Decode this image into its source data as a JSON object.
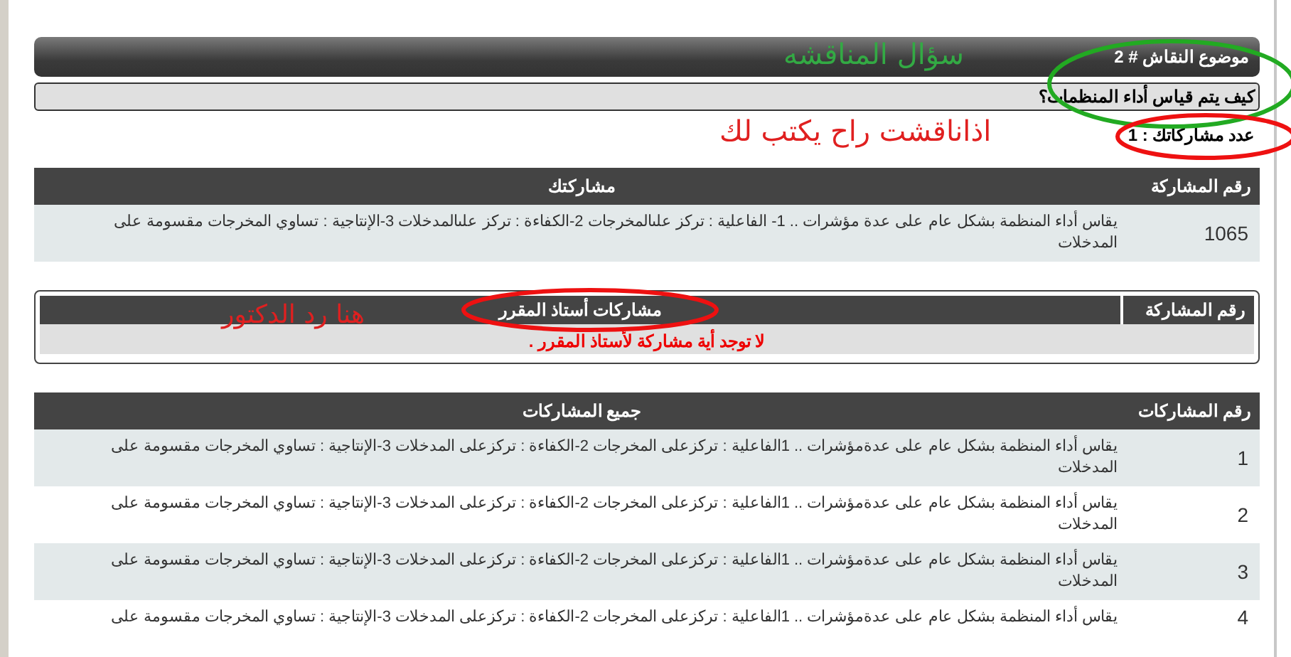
{
  "topic": {
    "title": "موضوع النقاش # 2",
    "question": "كيف يتم قياس أداء المنظمات؟",
    "count": "عدد مشاركاتك : 1"
  },
  "my_posts": {
    "columns": [
      "رقم المشاركة",
      "مشاركتك"
    ],
    "rows": [
      {
        "number": "1065",
        "text": "يقاس أداء المنظمة بشكل عام على عدة مؤشرات .. 1- الفاعلية : تركز علىالمخرجات 2-الكفاءة : تركز علىالمدخلات 3-الإنتاجية : تساوي المخرجات مقسومة على المدخلات"
      }
    ]
  },
  "instructor_posts": {
    "columns": [
      "رقم المشاركة",
      "مشاركات أستاذ المقرر"
    ],
    "empty_message": "لا توجد أية مشاركة لأستاذ المقرر ."
  },
  "all_posts": {
    "columns": [
      "رقم المشاركات",
      "جميع المشاركات"
    ],
    "rows": [
      {
        "number": "1",
        "text": "يقاس أداء المنظمة بشكل عام على عدةمؤشرات .. 1الفاعلية : تركزعلى المخرجات 2-الكفاءة : تركزعلى المدخلات 3-الإنتاجية : تساوي المخرجات مقسومة على المدخلات"
      },
      {
        "number": "2",
        "text": "يقاس أداء المنظمة بشكل عام على عدةمؤشرات .. 1الفاعلية : تركزعلى المخرجات 2-الكفاءة : تركزعلى المدخلات 3-الإنتاجية : تساوي المخرجات مقسومة على المدخلات"
      },
      {
        "number": "3",
        "text": "يقاس أداء المنظمة بشكل عام على عدةمؤشرات .. 1الفاعلية : تركزعلى المخرجات 2-الكفاءة : تركزعلى المدخلات 3-الإنتاجية : تساوي المخرجات مقسومة على المدخلات"
      },
      {
        "number": "4",
        "text": "يقاس أداء المنظمة بشكل عام على عدةمؤشرات .. 1الفاعلية : تركزعلى المخرجات 2-الكفاءة : تركزعلى المدخلات 3-الإنتاجية : تساوي المخرجات مقسومة على"
      }
    ]
  },
  "annotations": [
    {
      "kind": "text",
      "text": "سؤال المناقشه",
      "color": "#33aa44"
    },
    {
      "kind": "ellipse",
      "color": "#22aa22"
    },
    {
      "kind": "text",
      "text": "اذاناقشت راح يكتب لك",
      "color": "#e02020"
    },
    {
      "kind": "ellipse",
      "color": "#ee1111"
    },
    {
      "kind": "text",
      "text": "هنا رد الدكتور",
      "color": "#e02020"
    },
    {
      "kind": "ellipse",
      "color": "#ee1111"
    }
  ]
}
